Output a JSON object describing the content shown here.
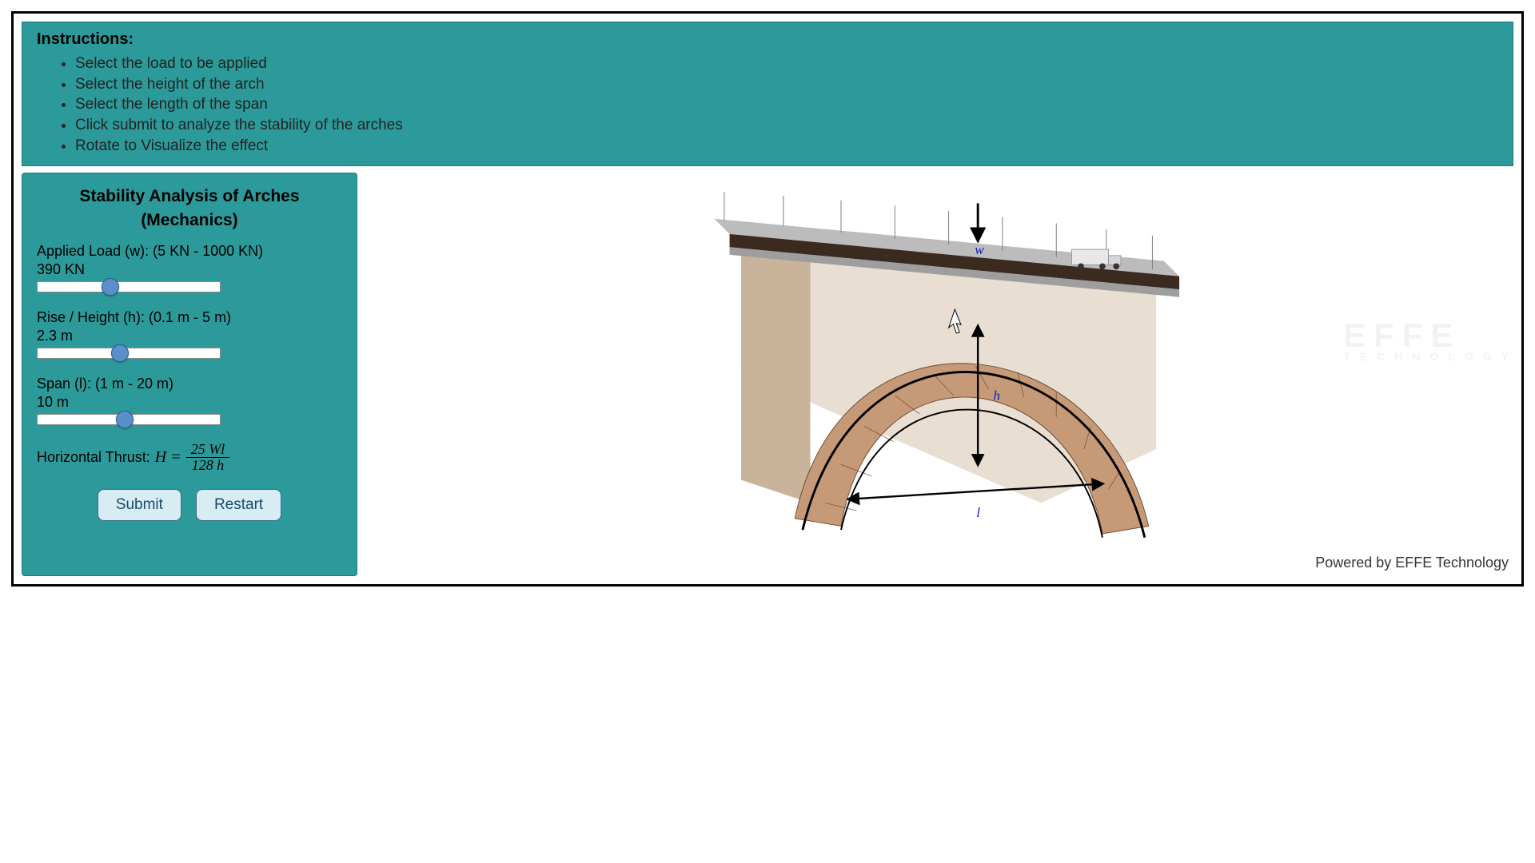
{
  "instructions": {
    "title": "Instructions:",
    "items": [
      "Select the load to be applied",
      "Select the height of the arch",
      "Select the length of the span",
      "Click submit to analyze the stability of the arches",
      "Rotate to Visualize the effect"
    ]
  },
  "controls": {
    "title_line1": "Stability Analysis of Arches",
    "title_line2": "(Mechanics)",
    "load": {
      "label": "Applied Load (w): (5 KN - 1000 KN)",
      "value_display": "390 KN",
      "min": 5,
      "max": 1000,
      "value": 390
    },
    "height": {
      "label": "Rise / Height (h): (0.1 m - 5 m)",
      "value_display": "2.3 m",
      "min": 0.1,
      "max": 5,
      "value": 2.3
    },
    "span": {
      "label": "Span (l): (1 m - 20 m)",
      "value_display": "10 m",
      "min": 1,
      "max": 20,
      "value": 10
    },
    "formula": {
      "lhs": "Horizontal Thrust:",
      "var": "H =",
      "numer": "25 Wl",
      "denom": "128 h"
    },
    "submit_label": "Submit",
    "restart_label": "Restart"
  },
  "viz": {
    "labels": {
      "w": "w",
      "h": "h",
      "l": "l"
    }
  },
  "footer": {
    "powered_by": "Powered by EFFE Technology"
  },
  "watermark": {
    "main": "EFFE",
    "sub": "TECHNOLOGY"
  }
}
